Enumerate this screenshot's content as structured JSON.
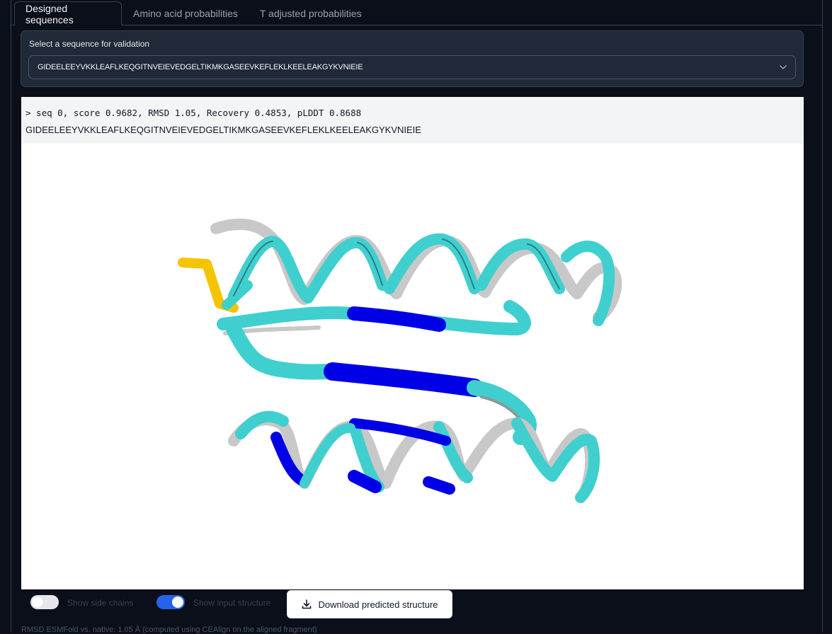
{
  "tabs": [
    {
      "label": "Designed sequences",
      "active": true
    },
    {
      "label": "Amino acid probabilities",
      "active": false
    },
    {
      "label": "T adjusted probabilities",
      "active": false
    }
  ],
  "selector": {
    "label": "Select a sequence for validation",
    "value": "GIDEELEEYVKKLEAFLKEQGITNVEIEVEDGELTIKMKGASEEVKEFLEKLKEELEAKGYKVNIEIE"
  },
  "sequence": {
    "header": "> seq 0, score 0.9682, RMSD 1.05, Recovery 0.4853, pLDDT 0.8688",
    "residues": "GIDEELEEYVKKLEAFLKEQGITNVEIEVEDGELTIKMKGASEEVKEFLEKLKEELEAKGYKVNIEIE"
  },
  "controls": {
    "side_chains_label": "Show side chains",
    "side_chains_on": false,
    "input_structure_label": "Show input structure",
    "input_structure_on": true,
    "download_label": "Download predicted structure"
  },
  "footer": {
    "text": "RMSD ESMFold vs. native: 1.05 Å (computed using CEAlign on the aligned fragment)"
  },
  "colors": {
    "page_bg": "#0b0f19",
    "toggle_on": "#2563eb",
    "cartoon_cyan": "#40cfcf",
    "cartoon_blue": "#0000e6",
    "cartoon_gray": "#c8c8c8",
    "cartoon_yellow": "#f5c400"
  }
}
